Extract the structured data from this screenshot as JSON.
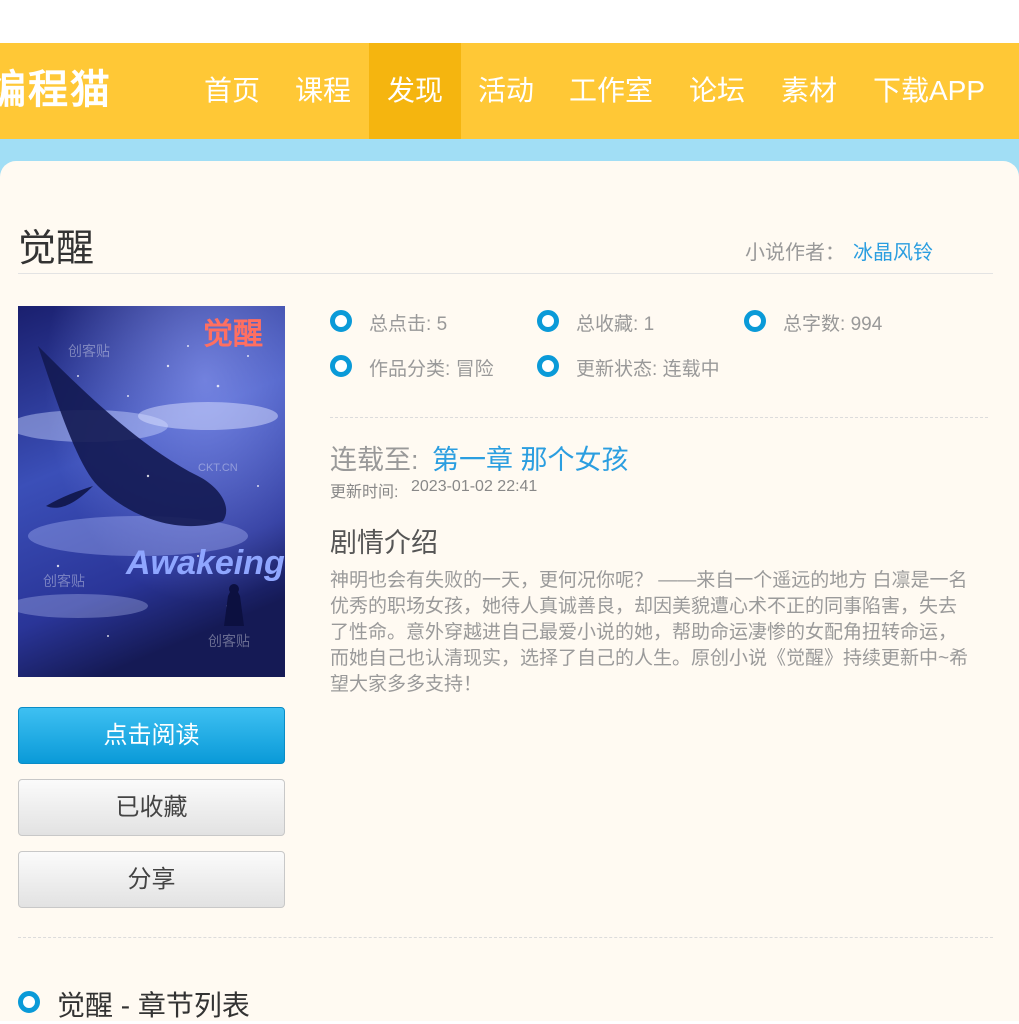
{
  "nav": {
    "logo": "编程猫",
    "items": [
      {
        "label": "首页",
        "active": false
      },
      {
        "label": "课程",
        "active": false
      },
      {
        "label": "发现",
        "active": true
      },
      {
        "label": "活动",
        "active": false
      },
      {
        "label": "工作室",
        "active": false
      },
      {
        "label": "论坛",
        "active": false
      },
      {
        "label": "素材",
        "active": false
      },
      {
        "label": "下载APP",
        "active": false
      }
    ]
  },
  "novel": {
    "title": "觉醒",
    "author_label": "小说作者：",
    "author_name": "冰晶风铃",
    "cover": {
      "title_text": "觉醒",
      "subtitle_text": "Awakeing",
      "watermark_1": "创客贴",
      "watermark_2": "CKT.CN",
      "watermark_3": "创客贴",
      "watermark_4": "创客贴",
      "colors": [
        "#1a1f6e",
        "#3b4fb8",
        "#ff6f61"
      ]
    },
    "stats": [
      {
        "label": "总点击:",
        "value": "5"
      },
      {
        "label": "总收藏:",
        "value": "1"
      },
      {
        "label": "总字数:",
        "value": "994"
      },
      {
        "label": "作品分类:",
        "value": "冒险"
      },
      {
        "label": "更新状态:",
        "value": "连载中"
      }
    ],
    "serial_label": "连载至:",
    "serial_chapter": "第一章 那个女孩",
    "update_label": "更新时间:",
    "update_time": "2023-01-02 22:41",
    "plot_title": "剧情介绍",
    "plot_body": "神明也会有失败的一天，更何况你呢？ ——来自一个遥远的地方 白凛是一名优秀的职场女孩，她待人真诚善良，却因美貌遭心术不正的同事陷害，失去了性命。意外穿越进自己最爱小说的她，帮助命运凄惨的女配角扭转命运，而她自己也认清现实，选择了自己的人生。原创小说《觉醒》持续更新中~希望大家多多支持！",
    "buttons": {
      "read": "点击阅读",
      "collected": "已收藏",
      "share": "分享"
    },
    "chapter_list_title": "觉醒 - 章节列表"
  },
  "colors": {
    "nav_bg": "#ffc836",
    "nav_active": "#f5b50f",
    "accent": "#0a9ad8",
    "link": "#2b9ee0",
    "band": "#a1def5"
  }
}
